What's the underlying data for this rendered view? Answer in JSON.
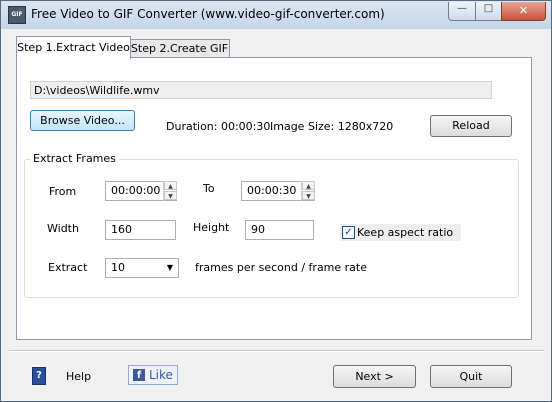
{
  "window": {
    "title": "Free Video to GIF Converter (www.video-gif-converter.com)",
    "app_icon_text": "GIF",
    "minimize_glyph": "—",
    "maximize_glyph": "□",
    "close_glyph": "✕"
  },
  "tabs": [
    {
      "label": "Step 1.Extract Video",
      "active": true
    },
    {
      "label": "Step 2.Create GIF",
      "active": false
    }
  ],
  "video": {
    "path": "D:\\videos\\Wildlife.wmv",
    "browse_label": "Browse Video...",
    "duration_text": "Duration: 00:00:30",
    "image_size_text": "Image Size: 1280x720",
    "reload_label": "Reload"
  },
  "extract": {
    "group_title": "Extract Frames",
    "from_label": "From",
    "from_value": "00:00:00",
    "to_label": "To",
    "to_value": "00:00:30",
    "width_label": "Width",
    "width_value": "160",
    "height_label": "Height",
    "height_value": "90",
    "keep_aspect_label": "Keep aspect ratio",
    "keep_aspect_checked": true,
    "extract_label": "Extract",
    "fps_value": "10",
    "fps_suffix": "frames per second / frame rate"
  },
  "footer": {
    "help_icon_glyph": "?",
    "help_label": "Help",
    "like_label": "Like",
    "fb_glyph": "f",
    "next_label": "Next >",
    "quit_label": "Quit"
  },
  "icons": {
    "spin_up": "▲",
    "spin_down": "▼",
    "dropdown": "▼",
    "check": "✓"
  }
}
